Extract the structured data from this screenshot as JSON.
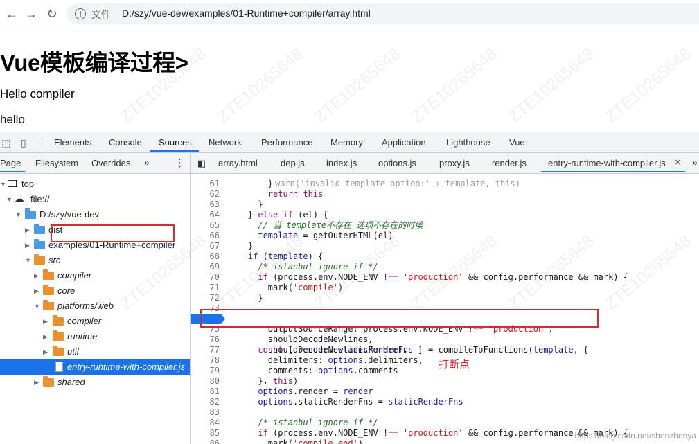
{
  "browser": {
    "back": "←",
    "forward": "→",
    "reload": "↻",
    "info": "i",
    "file_label": "文件",
    "url": "D:/szy/vue-dev/examples/01-Runtime+compiler/array.html"
  },
  "page": {
    "heading": "Vue模板编译过程>",
    "line1": "Hello compiler",
    "line2": "hello"
  },
  "devtools": {
    "tabs": [
      "Elements",
      "Console",
      "Sources",
      "Network",
      "Performance",
      "Memory",
      "Application",
      "Lighthouse",
      "Vue"
    ],
    "active_tab": "Sources",
    "navigator_tabs": [
      "Page",
      "Filesystem",
      "Overrides"
    ],
    "navigator_more": "»",
    "navigator_menu": "⋮",
    "tree": [
      {
        "label": "top"
      },
      {
        "label": "file://"
      },
      {
        "label": "D:/szy/vue-dev"
      },
      {
        "label": "dist"
      },
      {
        "label": "examples/01-Runtime+compiler"
      },
      {
        "label": "src"
      },
      {
        "label": "compiler"
      },
      {
        "label": "core"
      },
      {
        "label": "platforms/web"
      },
      {
        "label": "compiler"
      },
      {
        "label": "runtime"
      },
      {
        "label": "util"
      },
      {
        "label": "entry-runtime-with-compiler.js"
      },
      {
        "label": "shared"
      }
    ],
    "editor_tabs": [
      "array.html",
      "dep.js",
      "index.js",
      "options.js",
      "proxy.js",
      "render.js",
      "entry-runtime-with-compiler.js"
    ],
    "editor_close": "×",
    "editor_more": "»",
    "code_line_numbers": [
      "61",
      "62",
      "63",
      "64",
      "65",
      "66",
      "67",
      "68",
      "69",
      "70",
      "71",
      "72",
      "73",
      "74",
      "75",
      "76",
      "77",
      "78",
      "79",
      "80",
      "81",
      "82",
      "83",
      "84",
      "85",
      "86"
    ],
    "breakpoint_line": "74",
    "top_partial_line": "warn('invalid template option:' + template, this)",
    "annotation": "打断点"
  },
  "watermark": "ZTE10265648",
  "credit": "https://blog.csdn.net/shenzhenya"
}
